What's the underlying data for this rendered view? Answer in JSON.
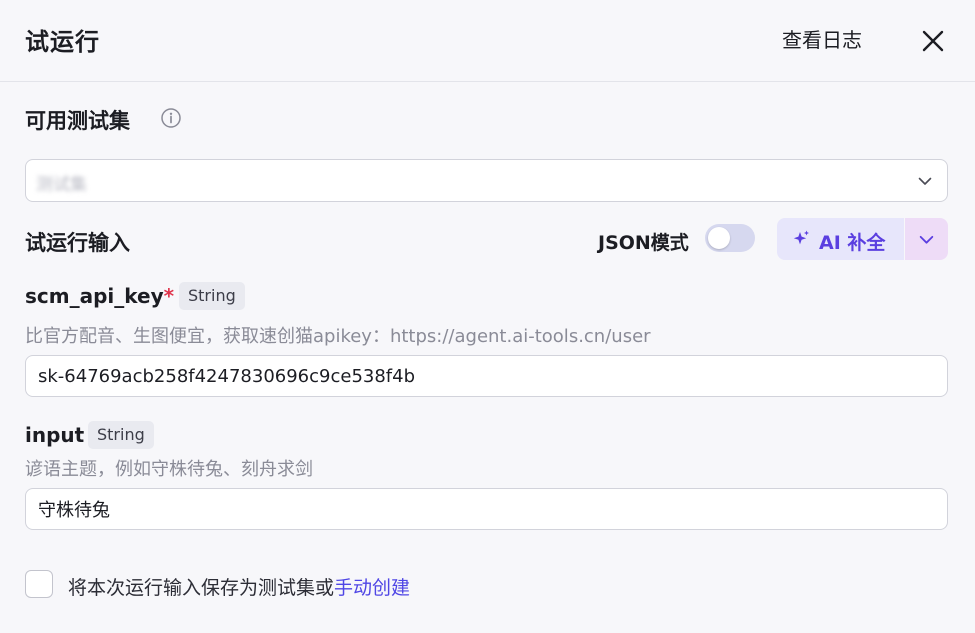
{
  "header": {
    "title": "试运行",
    "view_logs": "查看日志"
  },
  "test_set": {
    "label": "可用测试集",
    "selected": "测试集"
  },
  "run_input": {
    "label": "试运行输入",
    "json_mode_label": "JSON模式",
    "json_mode_on": false,
    "ai_button_label": "AI 补全"
  },
  "fields": [
    {
      "name": "scm_api_key",
      "required_mark": "*",
      "type": "String",
      "description": "比官方配音、生图便宜，获取速创猫apikey：https://agent.ai-tools.cn/user",
      "value": "sk-64769acb258f4247830696c9ce538f4b"
    },
    {
      "name": "input",
      "type": "String",
      "description": "谚语主题，例如守株待兔、刻舟求剑",
      "value": "守株待兔"
    }
  ],
  "save_option": {
    "text": "将本次运行输入保存为测试集或",
    "link": "手动创建",
    "checked": false
  },
  "colors": {
    "accent": "#5b3fe0",
    "link": "#4f46e5",
    "required": "#e0344c"
  }
}
